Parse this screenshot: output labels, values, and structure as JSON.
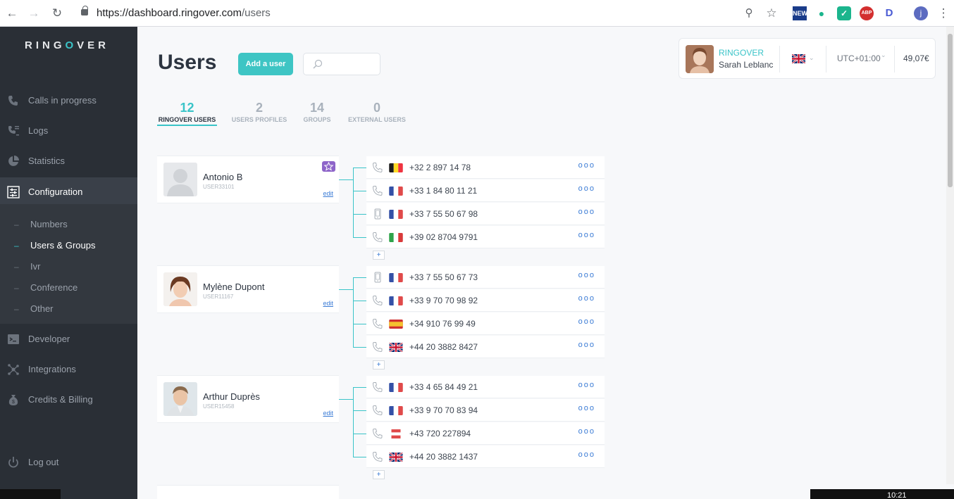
{
  "browser": {
    "url_host": "https://dashboard.ringover.com",
    "url_path": "/users"
  },
  "sidebar": {
    "logo_pre": "RING",
    "logo_o": "O",
    "logo_post": "VER",
    "items": [
      {
        "label": "Calls in progress",
        "icon": "phone-icon"
      },
      {
        "label": "Logs",
        "icon": "logs-icon"
      },
      {
        "label": "Statistics",
        "icon": "pie-chart-icon"
      },
      {
        "label": "Configuration",
        "icon": "sliders-icon"
      }
    ],
    "sub_items": [
      {
        "label": "Numbers"
      },
      {
        "label": "Users & Groups"
      },
      {
        "label": "Ivr"
      },
      {
        "label": "Conference"
      },
      {
        "label": "Other"
      }
    ],
    "bottom_items": [
      {
        "label": "Developer",
        "icon": "terminal-icon"
      },
      {
        "label": "Integrations",
        "icon": "network-icon"
      },
      {
        "label": "Credits & Billing",
        "icon": "money-bag-icon"
      }
    ],
    "logout": "Log out"
  },
  "header": {
    "title": "Users",
    "add_button": "Add a user",
    "search_placeholder": ""
  },
  "tabs": [
    {
      "count": "12",
      "label": "RINGOVER USERS"
    },
    {
      "count": "2",
      "label": "USERS PROFILES"
    },
    {
      "count": "14",
      "label": "GROUPS"
    },
    {
      "count": "0",
      "label": "EXTERNAL USERS"
    }
  ],
  "account": {
    "company": "RINGOVER",
    "name": "Sarah Leblanc",
    "timezone": "UTC+01:00",
    "credit": "49,07€"
  },
  "users": [
    {
      "name": "Antonio B",
      "id": "USER33101",
      "edit": "edit",
      "numbers": [
        {
          "type": "landline",
          "flag": "BE",
          "number": "+32 2 897 14 78"
        },
        {
          "type": "landline",
          "flag": "FR",
          "number": "+33 1 84 80 11 21"
        },
        {
          "type": "mobile",
          "flag": "FR",
          "number": "+33 7 55 50 67 98"
        },
        {
          "type": "landline",
          "flag": "IT",
          "number": "+39 02 8704 9791"
        }
      ]
    },
    {
      "name": "Mylène Dupont",
      "id": "USER11167",
      "edit": "edit",
      "numbers": [
        {
          "type": "mobile",
          "flag": "FR",
          "number": "+33 7 55 50 67 73"
        },
        {
          "type": "landline",
          "flag": "FR",
          "number": "+33 9 70 70 98 92"
        },
        {
          "type": "landline",
          "flag": "ES",
          "number": "+34 910 76 99 49"
        },
        {
          "type": "landline",
          "flag": "GB",
          "number": "+44 20 3882 8427"
        }
      ]
    },
    {
      "name": "Arthur Duprès",
      "id": "USER15458",
      "edit": "edit",
      "numbers": [
        {
          "type": "landline",
          "flag": "FR",
          "number": "+33 4 65 84 49 21"
        },
        {
          "type": "landline",
          "flag": "FR",
          "number": "+33 9 70 70 83 94"
        },
        {
          "type": "landline",
          "flag": "AT",
          "number": "+43 720 227894"
        },
        {
          "type": "landline",
          "flag": "GB",
          "number": "+44 20 3882 1437"
        }
      ]
    }
  ],
  "row_actions": "ooo",
  "add_number": "+",
  "taskbar": {
    "clock": "10:21"
  },
  "colors": {
    "accent": "#3ac4c8",
    "sidebar": "#2a2f36",
    "link": "#3a7bd5"
  }
}
